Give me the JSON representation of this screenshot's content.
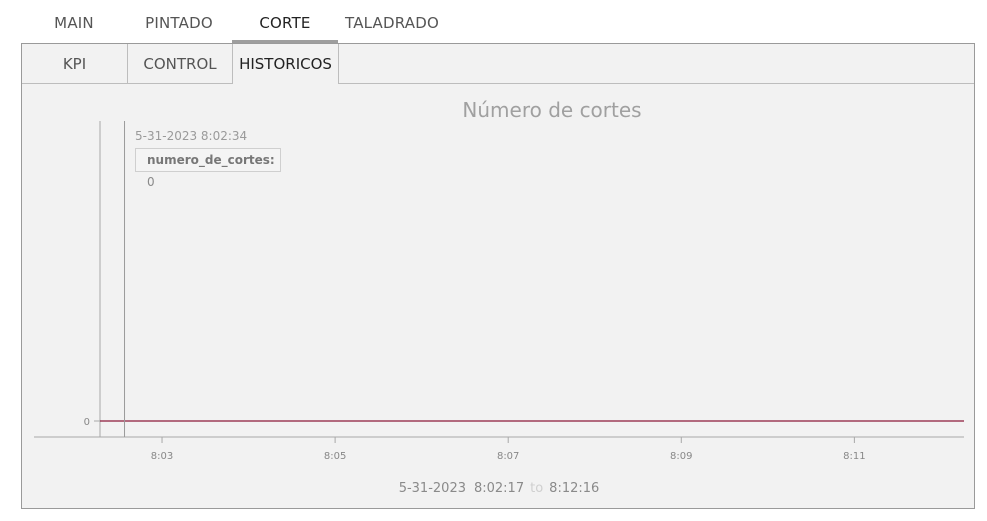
{
  "top_tabs": [
    {
      "label": "MAIN",
      "active": false
    },
    {
      "label": "PINTADO",
      "active": false
    },
    {
      "label": "CORTE",
      "active": true
    },
    {
      "label": "TALADRADO",
      "active": false
    }
  ],
  "sub_tabs": [
    {
      "label": "KPI",
      "active": false
    },
    {
      "label": "CONTROL",
      "active": false
    },
    {
      "label": "HISTORICOS",
      "active": true
    }
  ],
  "chart": {
    "title": "Número de cortes",
    "tooltip": {
      "time": "5-31-2023 8:02:34",
      "series_label": "numero_de_cortes:",
      "series_value": "0"
    },
    "range": {
      "date": "5-31-2023",
      "start": "8:02:17",
      "to_label": "to",
      "end": "8:12:16"
    }
  },
  "chart_data": {
    "type": "line",
    "title": "Número de cortes",
    "x_ticks": [
      "8:03",
      "8:05",
      "8:07",
      "8:09",
      "8:11"
    ],
    "y_ticks": [
      "0"
    ],
    "series": [
      {
        "name": "numero_de_cortes",
        "color": "#8b1a3a",
        "x": [
          "8:02:17",
          "8:12:16"
        ],
        "y": [
          0,
          0
        ]
      }
    ],
    "cursor_time": "8:02:34",
    "x_range": [
      "8:02:17",
      "8:12:16"
    ],
    "grid": false
  }
}
